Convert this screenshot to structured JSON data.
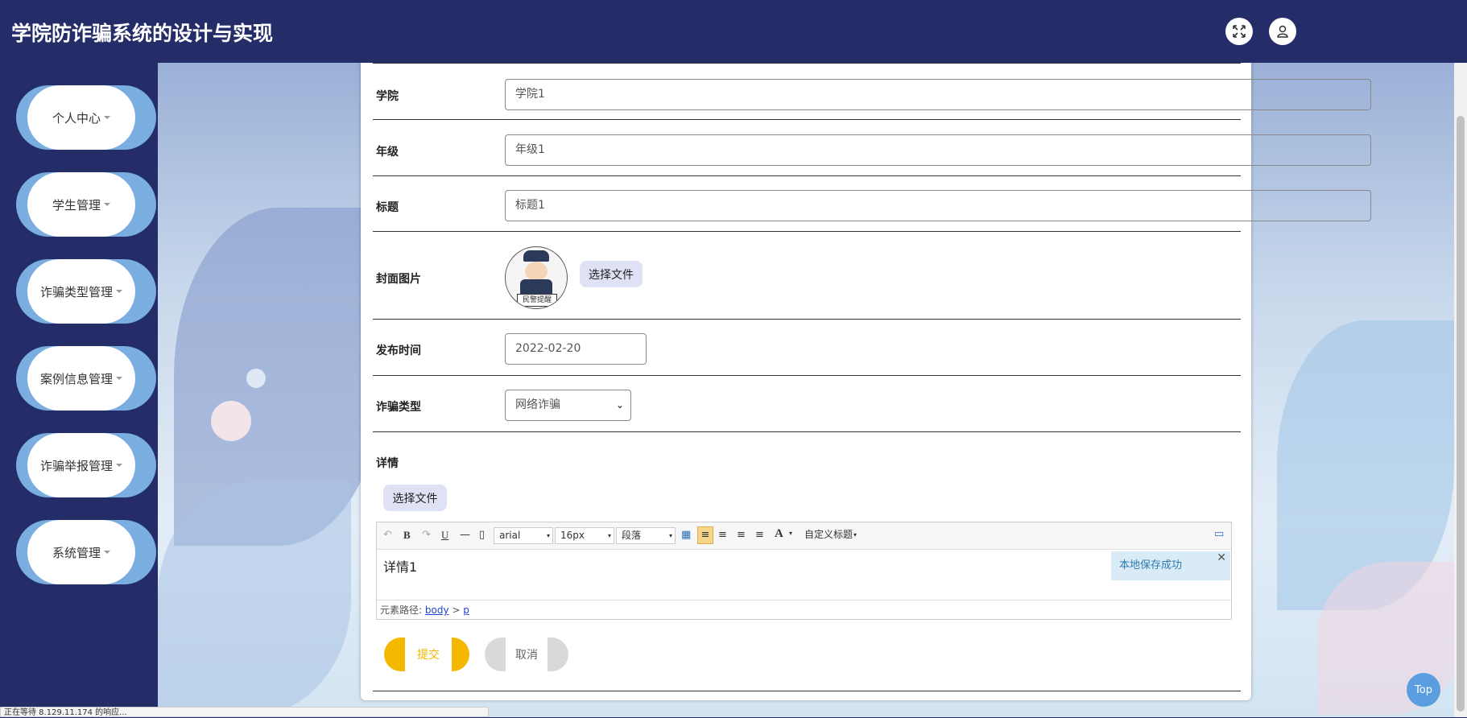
{
  "app": {
    "title": "学院防诈骗系统的设计与实现"
  },
  "header": {
    "icons": [
      "fullscreen-icon",
      "user-icon"
    ]
  },
  "sidebar": {
    "items": [
      {
        "label": "个人中心"
      },
      {
        "label": "学生管理"
      },
      {
        "label": "诈骗类型管理"
      },
      {
        "label": "案例信息管理"
      },
      {
        "label": "诈骗举报管理"
      },
      {
        "label": "系统管理"
      }
    ]
  },
  "form": {
    "college": {
      "label": "学院",
      "value": "学院1"
    },
    "grade": {
      "label": "年级",
      "value": "年级1"
    },
    "title": {
      "label": "标题",
      "value": "标题1"
    },
    "cover": {
      "label": "封面图片",
      "choose_file": "选择文件",
      "badge_text": "民警提醒"
    },
    "publish_time": {
      "label": "发布时间",
      "value": "2022-02-20"
    },
    "fraud_type": {
      "label": "诈骗类型",
      "selected": "网络诈骗"
    },
    "details": {
      "label": "详情",
      "choose_file": "选择文件"
    }
  },
  "editor": {
    "font": "arial",
    "size": "16px",
    "paragraph": "段落",
    "custom_heading": "自定义标题",
    "content": "详情1",
    "toast": "本地保存成功",
    "path_label": "元素路径:",
    "path_body": "body",
    "path_sep": ">",
    "path_p": "p"
  },
  "actions": {
    "submit": "提交",
    "cancel": "取消"
  },
  "misc": {
    "top_button": "Top",
    "status_text": "正在等待 8.129.11.174 的响应..."
  }
}
